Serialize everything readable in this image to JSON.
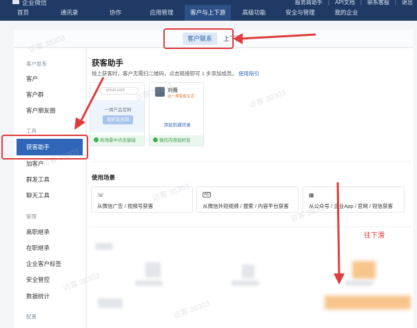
{
  "topbar": {
    "logo_text": "企业微信",
    "links": [
      "服务商助手",
      "API文档",
      "联系客服",
      "退出"
    ]
  },
  "nav": [
    {
      "label": "首页",
      "active": false
    },
    {
      "label": "通讯录",
      "active": false
    },
    {
      "label": "协作",
      "active": false
    },
    {
      "label": "应用管理",
      "active": false
    },
    {
      "label": "客户与上下游",
      "active": true
    },
    {
      "label": "高级功能",
      "active": false
    },
    {
      "label": "安全与管理",
      "active": false
    },
    {
      "label": "我的企业",
      "active": false
    }
  ],
  "tabs": {
    "active": "客户联系",
    "other": "上下游"
  },
  "sidebar": {
    "groups": [
      "客户联系",
      "工具",
      "管理",
      "配置"
    ],
    "items": [
      "客户",
      "客户群",
      "客户朋友圈",
      "获客助手",
      "加客户",
      "群发工具",
      "聊天工具",
      "离职继承",
      "在职继承",
      "企业客户标签",
      "安全管控",
      "数据统计"
    ],
    "active_item": "获客助手"
  },
  "main": {
    "title": "获客助手",
    "desc": "线上获客时，客户无需扫二维码，点击链接即可 1 步添加成员。",
    "desc_link": "使用指引",
    "card1": {
      "search_text": "yixun.com",
      "banner_text": "一周产品官网",
      "banner_button": "加好友咨询",
      "footer": "各场景中点击链接"
    },
    "card2": {
      "name": "刘薇",
      "sub": "@一周智能生活",
      "add_button": "添加到通讯录",
      "footer": "微信内添加好友"
    },
    "scenes_title": "使用场景",
    "scenes": [
      {
        "icon": "chat-icon",
        "glyph": "☏",
        "label": "从微信广告 / 视频号获客"
      },
      {
        "icon": "ad-icon",
        "glyph": "AD",
        "label": "从微信外短视频 / 搜索 / 内容平台获客"
      },
      {
        "icon": "grid-icon",
        "glyph": "▦",
        "label": "从公众号 / 企业App / 官网 / 短信获客"
      }
    ]
  },
  "annotation": {
    "scroll_hint": "往下滑"
  },
  "watermark": "访客 38303",
  "colors": {
    "topbar": "#1f3a64",
    "accent": "#2f66b8",
    "annotation_red": "#e03a3a",
    "success_green": "#3a9a48"
  }
}
